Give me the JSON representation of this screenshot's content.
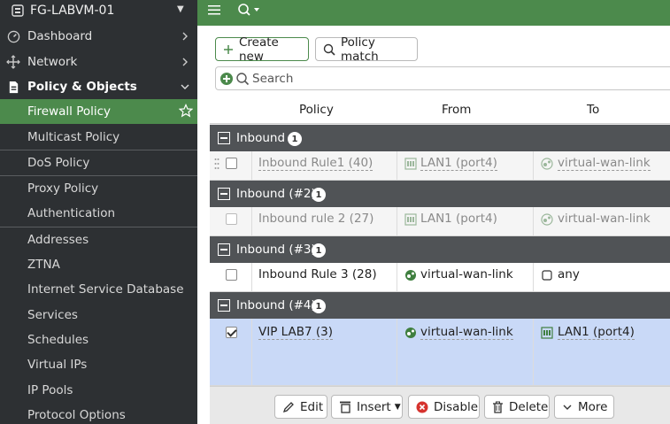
{
  "device": {
    "name": "FG-LABVM-01"
  },
  "sidebar": {
    "main_items": [
      {
        "label": "Dashboard",
        "icon": "dashboard-icon"
      },
      {
        "label": "Network",
        "icon": "network-icon"
      },
      {
        "label": "Policy & Objects",
        "icon": "policy-icon"
      }
    ],
    "sub_items": [
      {
        "label": "Firewall Policy",
        "active": true
      },
      {
        "label": "Multicast Policy"
      },
      {
        "label": "DoS Policy"
      },
      {
        "label": "Proxy Policy"
      },
      {
        "label": "Authentication"
      },
      {
        "label": "Addresses"
      },
      {
        "label": "ZTNA"
      },
      {
        "label": "Internet Service Database"
      },
      {
        "label": "Services"
      },
      {
        "label": "Schedules"
      },
      {
        "label": "Virtual IPs"
      },
      {
        "label": "IP Pools"
      },
      {
        "label": "Protocol Options"
      }
    ]
  },
  "toolbar": {
    "create_label": "Create new",
    "policy_match_label": "Policy match"
  },
  "search": {
    "placeholder": "Search"
  },
  "table": {
    "columns": [
      "Policy",
      "From",
      "To"
    ],
    "groups": [
      {
        "label": "Inbound",
        "count": "1",
        "row": {
          "policy": "Inbound Rule1 (40)",
          "from": "LAN1 (port4)",
          "to": "virtual-wan-link",
          "disabled": true
        }
      },
      {
        "label": "Inbound (#2)",
        "count": "1",
        "row": {
          "policy": "Inbound rule 2 (27)",
          "from": "LAN1 (port4)",
          "to": "virtual-wan-link",
          "disabled": true
        }
      },
      {
        "label": "Inbound (#3)",
        "count": "1",
        "row": {
          "policy": "Inbound Rule 3 (28)",
          "from": "virtual-wan-link",
          "to": "any",
          "disabled": false
        }
      },
      {
        "label": "Inbound (#4)",
        "count": "1",
        "row": {
          "policy": "VIP LAB7 (3)",
          "from": "virtual-wan-link",
          "to": "LAN1 (port4)",
          "disabled": false,
          "selected": true
        }
      }
    ]
  },
  "actions": {
    "edit": "Edit",
    "insert": "Insert",
    "disable": "Disable",
    "delete": "Delete",
    "more": "More"
  },
  "colors": {
    "brand_green": "#4c8a4c",
    "sidebar_bg": "#2d3033",
    "group_header_bg": "#505356",
    "selected_row": "#c9d9f7",
    "disable_red": "#d6332e"
  }
}
